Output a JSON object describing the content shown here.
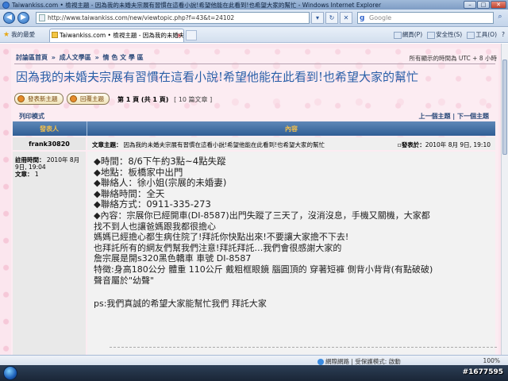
{
  "window": {
    "title": "Taiwankiss.com • 檢視主題 - 因為我的未婚夫宗展有習慣在這看小說!希望他能在此看到!也希望大家的幫忙 - Windows Internet Explorer",
    "minimize": "–",
    "maximize": "□",
    "close": "✕"
  },
  "browser": {
    "back_icon": "◀",
    "forward_icon": "▶",
    "url": "http://www.taiwankiss.com/new/viewtopic.php?f=43&t=24102",
    "search_engine": "g",
    "search_placeholder": "Google",
    "search_icon": "⌕",
    "addr_buttons": [
      "▾",
      "↻",
      "✕"
    ],
    "favorites_label": "我的最愛",
    "tab_title": "Taiwankiss.com • 檢視主題 - 因為我的未婚夫...",
    "tab_close": "x",
    "commands": [
      "網頁(P)",
      "安全性(S)",
      "工具(O)",
      "?"
    ]
  },
  "forum": {
    "breadcrumb": [
      "討論區首頁",
      "成人文學區",
      "情 色 文 學 區"
    ],
    "breadcrumb_sep": "»",
    "timezone": "所有顯示的時間為 UTC + 8 小時",
    "topic_title": "因為我的未婚夫宗展有習慣在這看小說!希望他能在此看到!也希望大家的幫忙",
    "new_topic_label": "發表新主題",
    "reply_label": "回覆主題",
    "page_info": "第 1 頁 (共 1 頁)",
    "post_count": "[ 10 篇文章 ]",
    "print_view": "列印模式",
    "prev_next": "上一個主題 | 下一個主題",
    "col_author": "發表人",
    "col_content": "內容",
    "post": {
      "author": "frank30820",
      "subject_label": "文章主題：",
      "subject": "因為我的未婚夫宗展有習慣在這看小說!希望他能在此看到!也希望大家的幫忙",
      "posted_label": "發表於：",
      "posted_date": "2010年 8月 9日, 19:10",
      "reg_label": "註冊時間：",
      "reg_date": "2010年 8月 9日, 19:04",
      "posts_label": "文章：",
      "posts_count": "1",
      "body_lines": [
        "◆時間：8/6下午約3點~4點失蹤",
        "◆地點：板橋家中出門",
        "◆聯絡人：徐小姐(宗展的未婚妻)",
        "◆聯絡時間：全天",
        "◆聯絡方式：0911-335-273",
        "◆內容：宗展你已經開車(DI-8587)出門失蹤了三天了，沒消沒息，手機又關機，大家都",
        "找不到人也讓爸媽跟我都很擔心",
        "媽媽已經擔心都生病住院了!拜託你快點出來!不要讓大家擔不下去!",
        "也拜託所有的網友們幫我們注意!拜託拜託…我們會很感謝大家的",
        "詹宗展是開s320黑色轎車 車號 DI-8587",
        "特徵:身高180公分 體重 110公斤 戴粗框眼鏡 腦圓頂的 穿著短褲 側背小背背(有點破破)",
        "聲音屬於\"幼聲\""
      ],
      "body_ps": "ps:我們真誠的希望大家能幫忙我們 拜託大家"
    }
  },
  "status": {
    "zone": "網際網路 | 受保護模式: 啟動",
    "zoom": "100%"
  },
  "watermark": "#1677595"
}
